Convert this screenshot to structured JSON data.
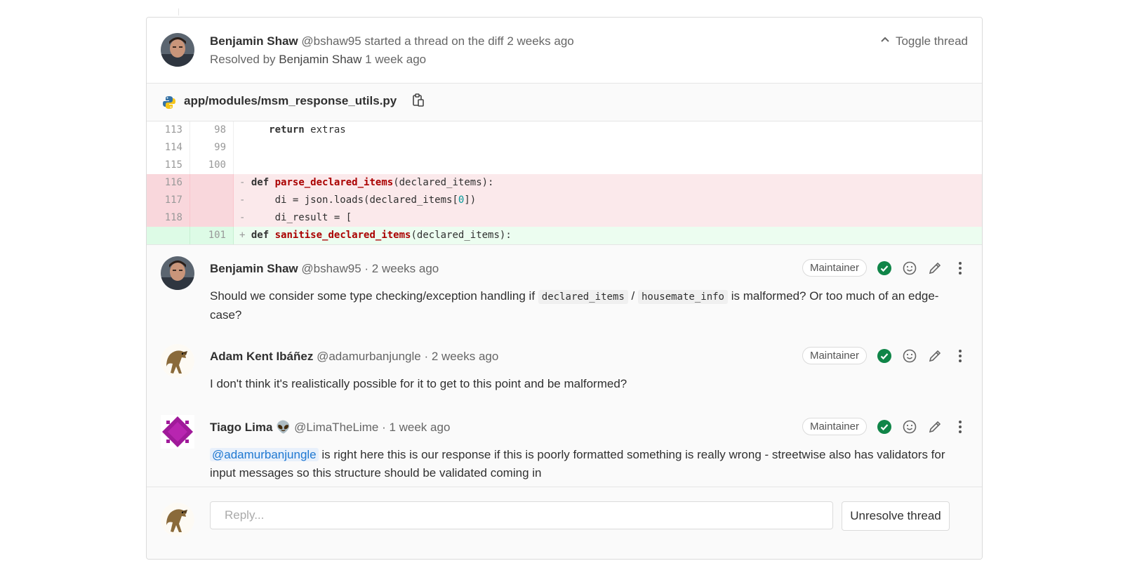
{
  "thread": {
    "header": {
      "author_name": "Benjamin Shaw",
      "author_handle": "@bshaw95",
      "action_text": "started a thread on the diff",
      "time": "2 weeks ago",
      "resolved_prefix": "Resolved by",
      "resolved_by": "Benjamin Shaw",
      "resolved_time": "1 week ago",
      "toggle_label": "Toggle thread"
    },
    "file": {
      "path": "app/modules/msm_response_utils.py",
      "icon": "python-icon"
    },
    "diff_lines": [
      {
        "old": "113",
        "new": "98",
        "type": "context",
        "code": "    return extras"
      },
      {
        "old": "114",
        "new": "99",
        "type": "context",
        "code": ""
      },
      {
        "old": "115",
        "new": "100",
        "type": "context",
        "code": ""
      },
      {
        "old": "116",
        "new": "",
        "type": "removed",
        "code": "def parse_declared_items(declared_items):"
      },
      {
        "old": "117",
        "new": "",
        "type": "removed",
        "code": "    di = json.loads(declared_items[0])"
      },
      {
        "old": "118",
        "new": "",
        "type": "removed",
        "code": "    di_result = ["
      },
      {
        "old": "",
        "new": "101",
        "type": "added",
        "code": "def sanitise_declared_items(declared_items):"
      }
    ],
    "notes": [
      {
        "author": "Benjamin Shaw",
        "handle": "@bshaw95",
        "time": "· 2 weeks ago",
        "role": "Maintainer",
        "body_parts": {
          "t1": "Should we consider some type checking/exception handling if ",
          "c1": "declared_items",
          "t2": " / ",
          "c2": "housemate_info",
          "t3": " is malformed? Or too much of an edge-case?"
        }
      },
      {
        "author": "Adam Kent Ibáñez",
        "handle": "@adamurbanjungle",
        "time": "· 2 weeks ago",
        "role": "Maintainer",
        "body": "I don't think it's realistically possible for it to get to this point and be malformed?"
      },
      {
        "author": "Tiago Lima",
        "emoji": "👽",
        "handle": "@LimaTheLime",
        "time": "· 1 week ago",
        "role": "Maintainer",
        "mention": "@adamurbanjungle",
        "body": " is right here this is our response if this is poorly formatted something is really wrong - streetwise also has validators for input messages so this structure should be validated coming in"
      }
    ],
    "reply": {
      "placeholder": "Reply...",
      "unresolve_label": "Unresolve thread"
    },
    "colors": {
      "resolved_check": "#108548",
      "removed_bg": "#fbe9eb",
      "added_bg": "#ecfdf0",
      "mention": "#1f78d1"
    }
  }
}
